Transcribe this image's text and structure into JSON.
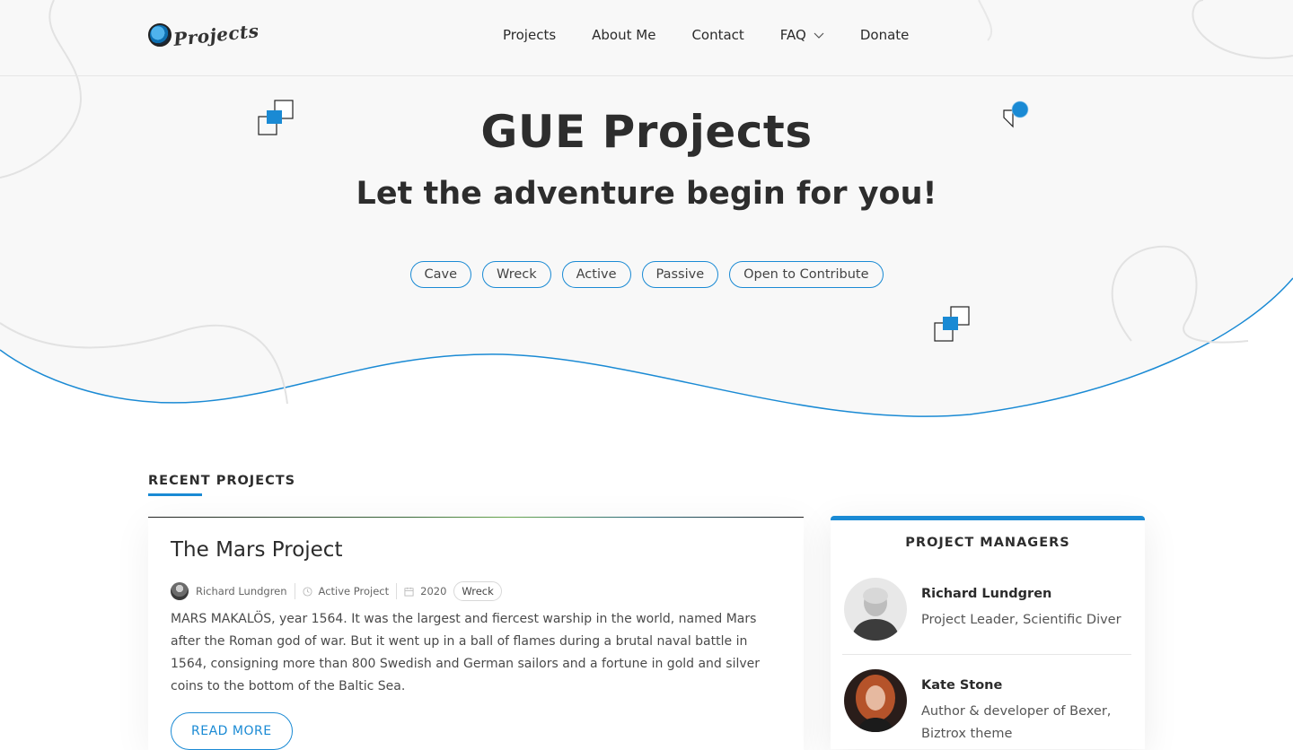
{
  "header": {
    "logo_text": "Projects",
    "nav": [
      {
        "label": "Projects"
      },
      {
        "label": "About Me"
      },
      {
        "label": "Contact"
      },
      {
        "label": "FAQ"
      },
      {
        "label": "Donate"
      }
    ]
  },
  "hero": {
    "title": "GUE Projects",
    "subtitle": "Let the adventure begin for you!",
    "tags": [
      "Cave",
      "Wreck",
      "Active",
      "Passive",
      "Open to Contribute"
    ]
  },
  "recent": {
    "section_title": "RECENT PROJECTS",
    "post": {
      "title": "The Mars Project",
      "author": "Richard Lundgren",
      "status": "Active Project",
      "year": "2020",
      "category": "Wreck",
      "excerpt": "MARS MAKALÖS, year 1564. It was the largest and fiercest warship in the world, named Mars after the Roman god of war. But it went up in a ball of flames during a brutal naval battle in 1564, consigning more than 800 Swedish and German sailors and a fortune in gold and silver coins to the bottom of the Baltic Sea.",
      "read_more": "READ MORE"
    }
  },
  "managers": {
    "title": "PROJECT MANAGERS",
    "people": [
      {
        "name": "Richard Lundgren",
        "role": "Project Leader, Scientific Diver"
      },
      {
        "name": "Kate Stone",
        "role": "Author & developer of Bexer, Biztrox theme"
      }
    ]
  },
  "colors": {
    "accent": "#1a8ad4",
    "hero_bg": "#f8f8f8",
    "text_dark": "#2d2d2d"
  }
}
